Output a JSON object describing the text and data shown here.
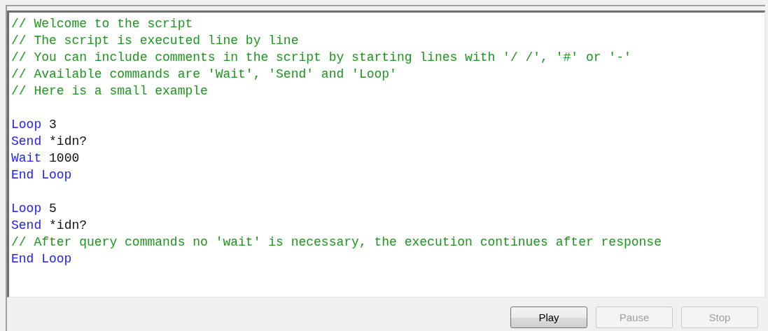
{
  "script_lines": [
    {
      "kind": "comment",
      "text": "// Welcome to the script"
    },
    {
      "kind": "comment",
      "text": "// The script is executed line by line"
    },
    {
      "kind": "comment",
      "text": "// You can include comments in the script by starting lines with '/ /', '#' or '-'"
    },
    {
      "kind": "comment",
      "text": "// Available commands are 'Wait', 'Send' and 'Loop'"
    },
    {
      "kind": "comment",
      "text": "// Here is a small example"
    },
    {
      "kind": "blank"
    },
    {
      "kind": "command",
      "keyword": "Loop",
      "argument": "3"
    },
    {
      "kind": "command",
      "keyword": "Send",
      "argument": "*idn?"
    },
    {
      "kind": "command",
      "keyword": "Wait",
      "argument": "1000"
    },
    {
      "kind": "command",
      "keyword": "End Loop"
    },
    {
      "kind": "blank"
    },
    {
      "kind": "command",
      "keyword": "Loop",
      "argument": "5"
    },
    {
      "kind": "command",
      "keyword": "Send",
      "argument": "*idn?"
    },
    {
      "kind": "comment",
      "text": "// After query commands no 'wait' is necessary, the execution continues after response"
    },
    {
      "kind": "command",
      "keyword": "End Loop"
    }
  ],
  "buttons": [
    {
      "label": "Play",
      "disabled": false
    },
    {
      "label": "Pause",
      "disabled": true
    },
    {
      "label": "Stop",
      "disabled": true
    }
  ]
}
